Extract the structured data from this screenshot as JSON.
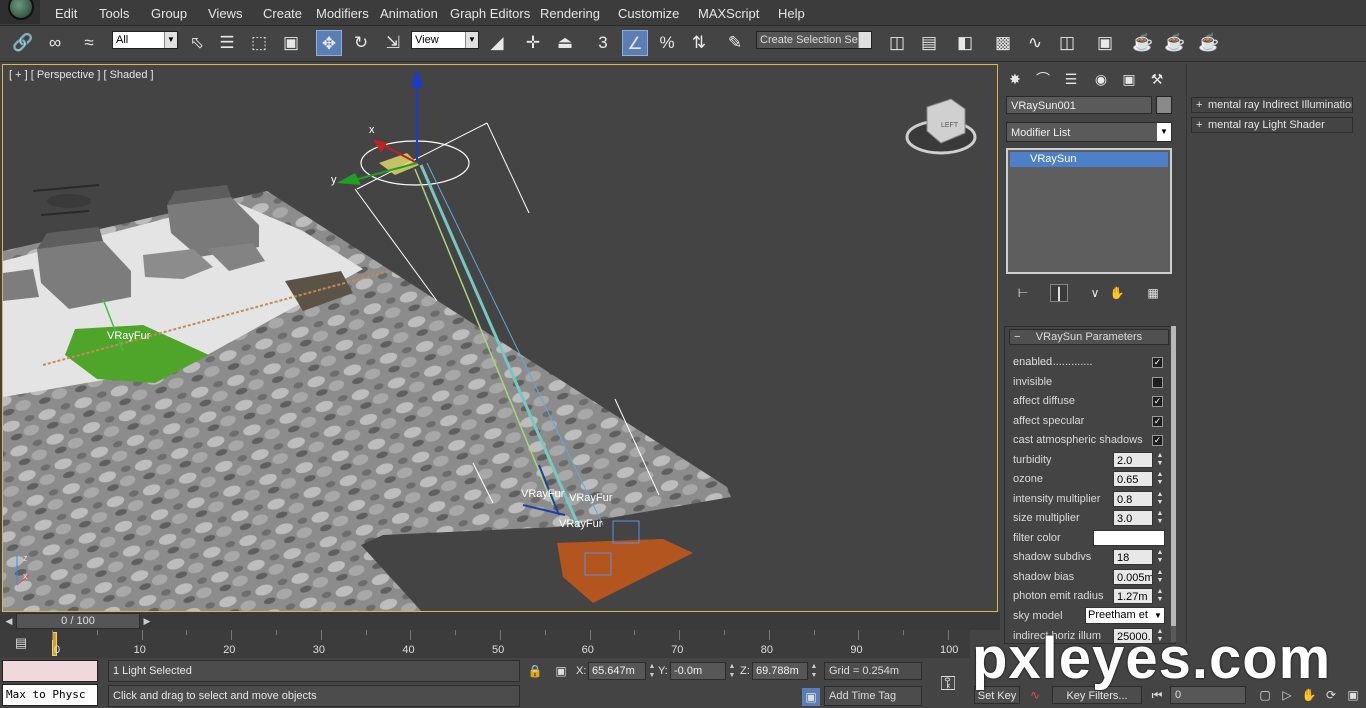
{
  "menu": {
    "items": [
      "Edit",
      "Tools",
      "Group",
      "Views",
      "Create",
      "Modifiers",
      "Animation",
      "Graph Editors",
      "Rendering",
      "Customize",
      "MAXScript",
      "Help"
    ]
  },
  "toolbar": {
    "selection_filter": "All",
    "reference_coord": "View",
    "named_selection_placeholder": "Create Selection Se",
    "snap_label": "3",
    "icons": [
      "link-icon",
      "unlink-icon",
      "bind-space-warp-icon",
      "select-object-icon",
      "select-by-name-icon",
      "rectangular-region-icon",
      "window-crossing-icon",
      "select-move-icon",
      "select-rotate-icon",
      "select-scale-icon",
      "pivot-icon",
      "manipulate-icon",
      "keyboard-shortcut-icon",
      "snaps-toggle-icon",
      "angle-snap-icon",
      "percent-snap-icon",
      "spinner-snap-icon",
      "edit-named-selection-icon",
      "mirror-icon",
      "align-icon",
      "layer-manager-icon",
      "graphite-ribbon-icon",
      "curve-editor-icon",
      "schematic-view-icon",
      "material-editor-icon",
      "render-setup-icon",
      "rendered-frame-icon",
      "render-production-icon"
    ]
  },
  "viewport": {
    "label": "[ + ] [ Perspective ] [ Shaded ]",
    "fur_labels": [
      "VRayFur",
      "VRayFur",
      "VRayFur",
      "VRayFur"
    ],
    "gizmo_axes": [
      "x",
      "y"
    ],
    "viewcube_face": "LEFT",
    "axis_tripod": [
      "z",
      "x"
    ]
  },
  "command_panel": {
    "object_name": "VRaySun001",
    "modifier_list": "Modifier List",
    "stack_items": [
      "VRaySun"
    ],
    "rollout_title": "VRaySun Parameters",
    "params": [
      {
        "label": "enabled",
        "type": "check",
        "checked": true
      },
      {
        "label": "invisible",
        "type": "check",
        "checked": false
      },
      {
        "label": "affect diffuse",
        "type": "check",
        "checked": true
      },
      {
        "label": "affect specular",
        "type": "check",
        "checked": true
      },
      {
        "label": "cast atmospheric shadows",
        "type": "check",
        "checked": true
      },
      {
        "label": "turbidity",
        "type": "spinner",
        "value": "2.0"
      },
      {
        "label": "ozone",
        "type": "spinner",
        "value": "0.65"
      },
      {
        "label": "intensity multiplier",
        "type": "spinner",
        "value": "0.8"
      },
      {
        "label": "size multiplier",
        "type": "spinner",
        "value": "3.0"
      },
      {
        "label": "filter color",
        "type": "color",
        "value": "#ffffff"
      },
      {
        "label": "shadow subdivs",
        "type": "spinner",
        "value": "18"
      },
      {
        "label": "shadow bias",
        "type": "spinner",
        "value": "0.005m"
      },
      {
        "label": "photon emit radius",
        "type": "spinner",
        "value": "1.27m"
      },
      {
        "label": "sky model",
        "type": "select",
        "value": "Preetham et"
      },
      {
        "label": "indirect horiz illum",
        "type": "spinner",
        "value": "25000."
      }
    ]
  },
  "right_list": {
    "items": [
      "mental ray Indirect Illumination",
      "mental ray Light Shader"
    ]
  },
  "time_slider": {
    "frame_text": "0 / 100",
    "ticks": [
      "0",
      "10",
      "20",
      "30",
      "40",
      "50",
      "60",
      "70",
      "80",
      "90",
      "100"
    ]
  },
  "status": {
    "listener_text": "Max to Physc",
    "selection_status": "1 Light Selected",
    "prompt": "Click and drag to select and move objects",
    "x_label": "X:",
    "x_value": "65.647m",
    "y_label": "Y:",
    "y_value": "-0.0m",
    "z_label": "Z:",
    "z_value": "69.788m",
    "grid": "Grid = 0.254m",
    "add_time_tag": "Add Time Tag",
    "set_key": "Set Key",
    "key_filters": "Key Filters...",
    "frame_value": "0"
  },
  "watermark": "pxleyes.com"
}
